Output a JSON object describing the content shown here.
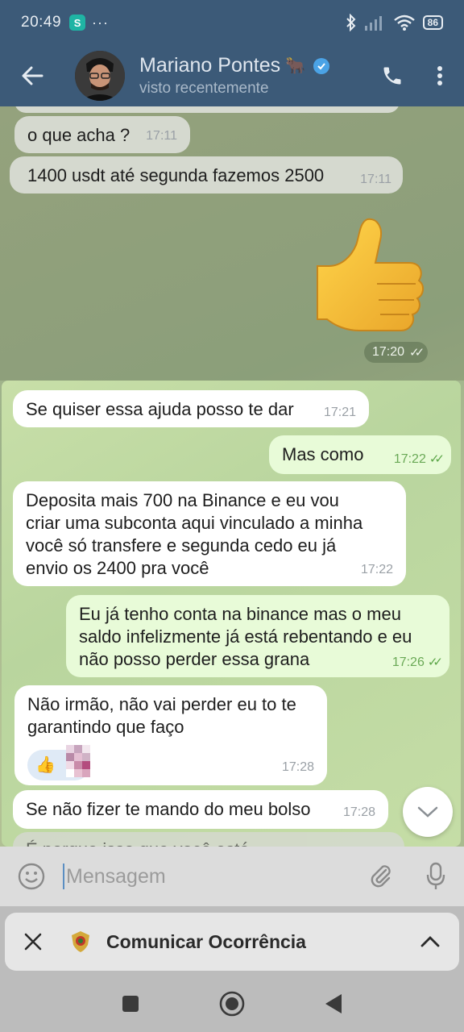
{
  "status_bar": {
    "time": "20:49",
    "app_badge": "S",
    "more": "···",
    "battery": "86"
  },
  "header": {
    "name": "Mariano Pontes",
    "status": "visto recentemente",
    "name_emoji": "🐂"
  },
  "messages": [
    {
      "text": "o que acha ?",
      "time": "17:11",
      "dir": "in"
    },
    {
      "text": "1400 usdt até segunda fazemos 2500",
      "time": "17:11",
      "dir": "in"
    },
    {
      "sticker": "👍",
      "time": "17:20",
      "dir": "out"
    },
    {
      "text": "Se quiser essa ajuda posso te dar",
      "time": "17:21",
      "dir": "in"
    },
    {
      "text": "Mas como",
      "time": "17:22",
      "dir": "out"
    },
    {
      "lines": [
        "Deposita mais 700 na Binance e eu vou",
        "criar uma subconta aqui vinculado a minha",
        "você só transfere e segunda cedo eu já",
        "envio os 2400 pra você"
      ],
      "time": "17:22",
      "dir": "in"
    },
    {
      "lines": [
        "Eu já tenho conta na binance mas o meu",
        "saldo infelizmente já está rebentando e eu",
        "não posso perder essa grana"
      ],
      "time": "17:26",
      "dir": "out"
    },
    {
      "lines": [
        "Não irmão, não vai perder eu to te",
        "garantindo que faço"
      ],
      "time": "17:28",
      "dir": "in",
      "reaction": "👍"
    },
    {
      "text": "Se não fizer te mando do meu bolso",
      "time": "17:28",
      "dir": "in"
    },
    {
      "text": "É porque isso que você está...",
      "time": "",
      "dir": "in"
    }
  ],
  "input": {
    "placeholder": "Mensagem"
  },
  "sheet": {
    "title": "Comunicar Ocorrência"
  },
  "colors": {
    "header": "#3c5a78",
    "out_bubble": "#e8fbd8",
    "in_bubble": "#ffffff",
    "check": "#5ba547"
  },
  "icons": [
    "back-arrow-icon",
    "verified-icon",
    "phone-icon",
    "more-vertical-icon",
    "double-check-icon",
    "chevron-down-icon",
    "emoji-icon",
    "attach-icon",
    "mic-icon",
    "close-icon",
    "police-badge-icon",
    "chevron-up-icon",
    "recents-icon",
    "home-icon",
    "back-icon"
  ]
}
